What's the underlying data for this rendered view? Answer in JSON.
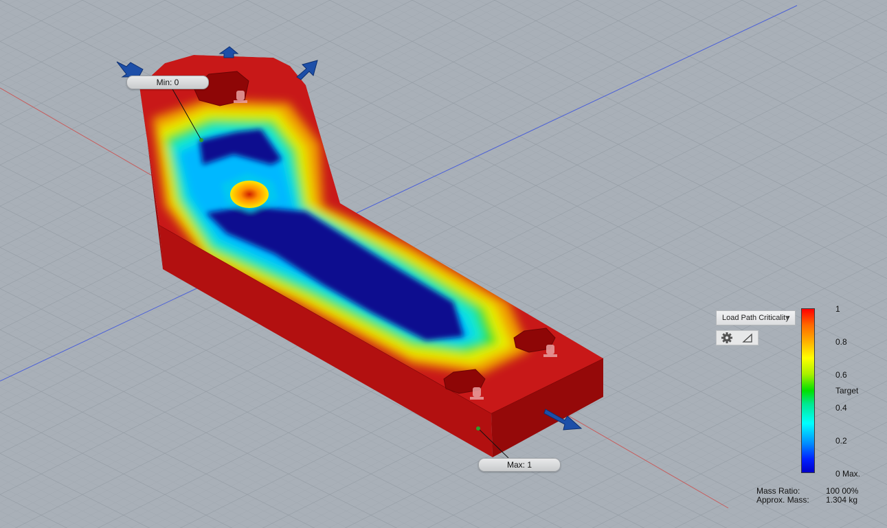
{
  "markers": {
    "min_label": "Min: 0",
    "max_label": "Max: 1"
  },
  "legend": {
    "result_type": "Load Path Criticality",
    "ticks": [
      "1",
      "0.8",
      "0.6",
      "0.4",
      "0.2",
      "0 Max."
    ],
    "target_label": "Target",
    "icons": {
      "settings": "gear-icon",
      "ruler": "triangle-ruler-icon"
    },
    "gradient_colors": [
      "#ff0000",
      "#ffff00",
      "#00e000",
      "#00ffff",
      "#0000c8"
    ]
  },
  "stats": {
    "mass_ratio_label": "Mass Ratio:",
    "mass_ratio_value": "100 00%",
    "approx_mass_label": "Approx. Mass:",
    "approx_mass_value": "1.304 kg"
  },
  "colors": {
    "background": "#a9b0b8",
    "grid_major": "#97a0a9",
    "body_red": "#c21414",
    "critical_blue": "#0b0f8f",
    "axis_x": "#c85a5a",
    "axis_z": "#4a5fd8"
  }
}
